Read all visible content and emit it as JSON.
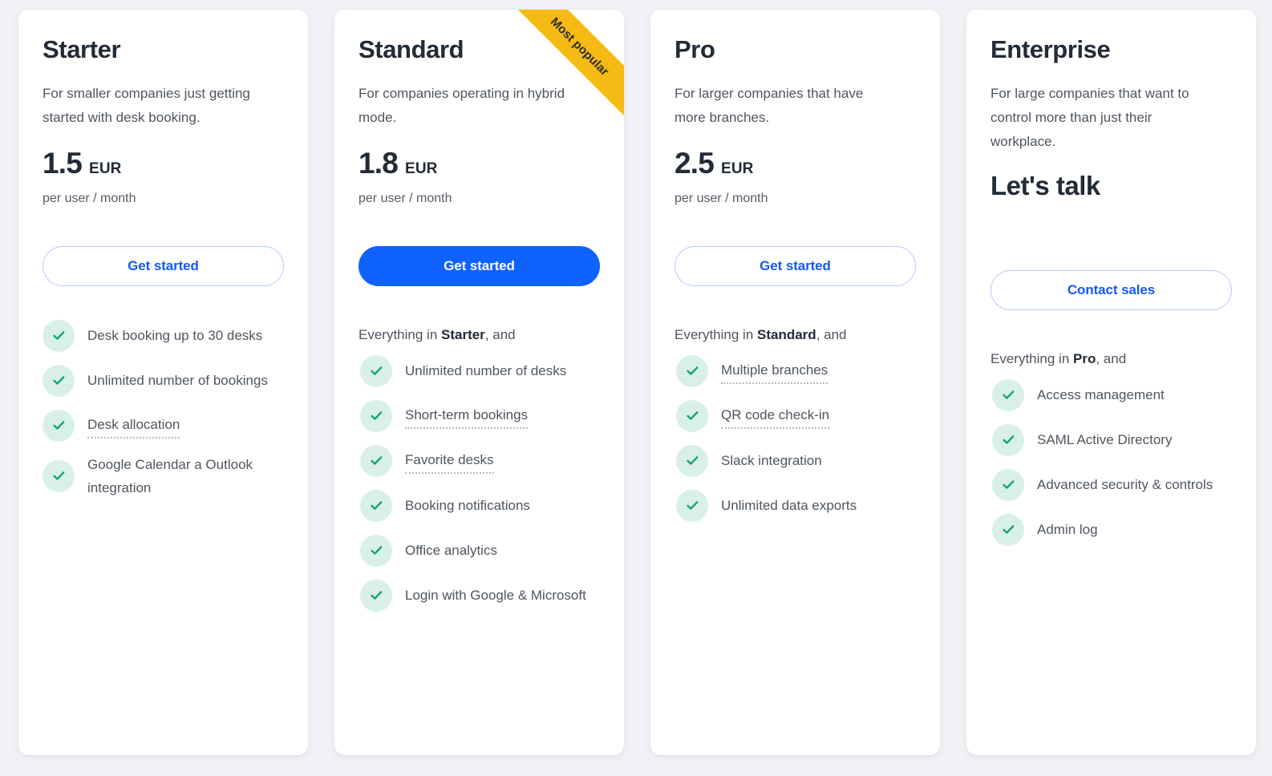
{
  "colors": {
    "page_background": "#f1f2f6",
    "card_background": "#ffffff",
    "accent_blue": "#0f62fe",
    "outline_blue_border": "#b9c9fb",
    "heading": "#222b36",
    "body_text": "#4e5560",
    "check_circle": "#d9f0e7",
    "check_mark": "#11a06d",
    "ribbon_yellow": "#f5bb14"
  },
  "ribbon": {
    "label": "Most popular"
  },
  "plans": [
    {
      "name": "Starter",
      "description": "For smaller companies just getting started with desk booking.",
      "price_amount": "1.5",
      "price_currency": "EUR",
      "price_period": "per user / month",
      "price_is_text": false,
      "cta_label": "Get started",
      "cta_style": "outline",
      "popular": false,
      "inherit_line": null,
      "features": [
        {
          "label": "Desk booking up to 30 desks",
          "tooltip": false
        },
        {
          "label": "Unlimited number of bookings",
          "tooltip": false
        },
        {
          "label": "Desk allocation",
          "tooltip": true
        },
        {
          "label": "Google Calendar a Outlook integration",
          "tooltip": false
        }
      ]
    },
    {
      "name": "Standard",
      "description": "For companies operating in hybrid mode.",
      "price_amount": "1.8",
      "price_currency": "EUR",
      "price_period": "per user / month",
      "price_is_text": false,
      "cta_label": "Get started",
      "cta_style": "filled",
      "popular": true,
      "inherit_line": {
        "prefix": "Everything in ",
        "plan": "Starter",
        "suffix": ", and"
      },
      "features": [
        {
          "label": "Unlimited number of desks",
          "tooltip": false
        },
        {
          "label": "Short-term bookings",
          "tooltip": true
        },
        {
          "label": "Favorite desks",
          "tooltip": true
        },
        {
          "label": "Booking notifications",
          "tooltip": false
        },
        {
          "label": "Office analytics",
          "tooltip": false
        },
        {
          "label": "Login with Google & Microsoft",
          "tooltip": false
        }
      ]
    },
    {
      "name": "Pro",
      "description": "For larger companies that have more branches.",
      "price_amount": "2.5",
      "price_currency": "EUR",
      "price_period": "per user / month",
      "price_is_text": false,
      "cta_label": "Get started",
      "cta_style": "outline",
      "popular": false,
      "inherit_line": {
        "prefix": "Everything in ",
        "plan": "Standard",
        "suffix": ", and"
      },
      "features": [
        {
          "label": "Multiple branches",
          "tooltip": true
        },
        {
          "label": "QR code check-in",
          "tooltip": true
        },
        {
          "label": "Slack integration",
          "tooltip": false
        },
        {
          "label": "Unlimited data exports",
          "tooltip": false
        }
      ]
    },
    {
      "name": "Enterprise",
      "description": "For large companies that want to control more than just their workplace.",
      "price_amount": "Let's talk",
      "price_currency": "",
      "price_period": "",
      "price_is_text": true,
      "cta_label": "Contact sales",
      "cta_style": "outline",
      "popular": false,
      "inherit_line": {
        "prefix": "Everything in ",
        "plan": "Pro",
        "suffix": ", and"
      },
      "features": [
        {
          "label": "Access management",
          "tooltip": false
        },
        {
          "label": "SAML Active Directory",
          "tooltip": false
        },
        {
          "label": "Advanced security & controls",
          "tooltip": false
        },
        {
          "label": "Admin log",
          "tooltip": false
        }
      ]
    }
  ]
}
